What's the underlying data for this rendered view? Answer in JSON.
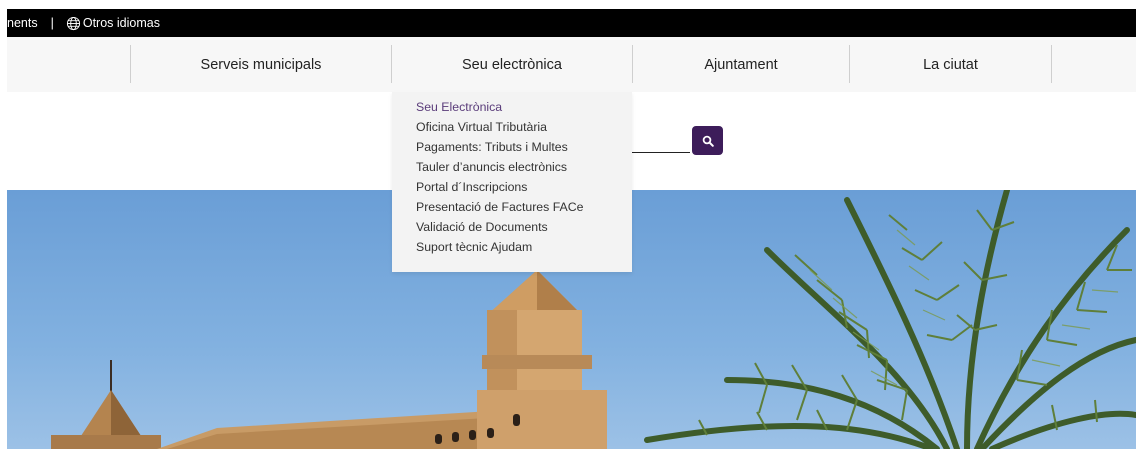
{
  "topbar": {
    "partial_link": "nents",
    "separator": "|",
    "languages_label": "Otros idiomas"
  },
  "nav": {
    "items": [
      {
        "label": "Serveis municipals"
      },
      {
        "label": "Seu electrònica"
      },
      {
        "label": "Ajuntament"
      },
      {
        "label": "La ciutat"
      }
    ]
  },
  "dropdown": {
    "items": [
      {
        "label": "Seu Electrònica"
      },
      {
        "label": "Oficina Virtual Tributària"
      },
      {
        "label": "Pagaments: Tributs i Multes"
      },
      {
        "label": "Tauler d’anuncis electrònics"
      },
      {
        "label": "Portal d´Inscripcions"
      },
      {
        "label": "Presentació de Factures FACe"
      },
      {
        "label": "Validació de Documents"
      },
      {
        "label": "Suport tècnic Ajudam"
      }
    ]
  },
  "colors": {
    "topbar_bg": "#000000",
    "search_button": "#3d1d5a",
    "active_link": "#5a3c7a"
  }
}
